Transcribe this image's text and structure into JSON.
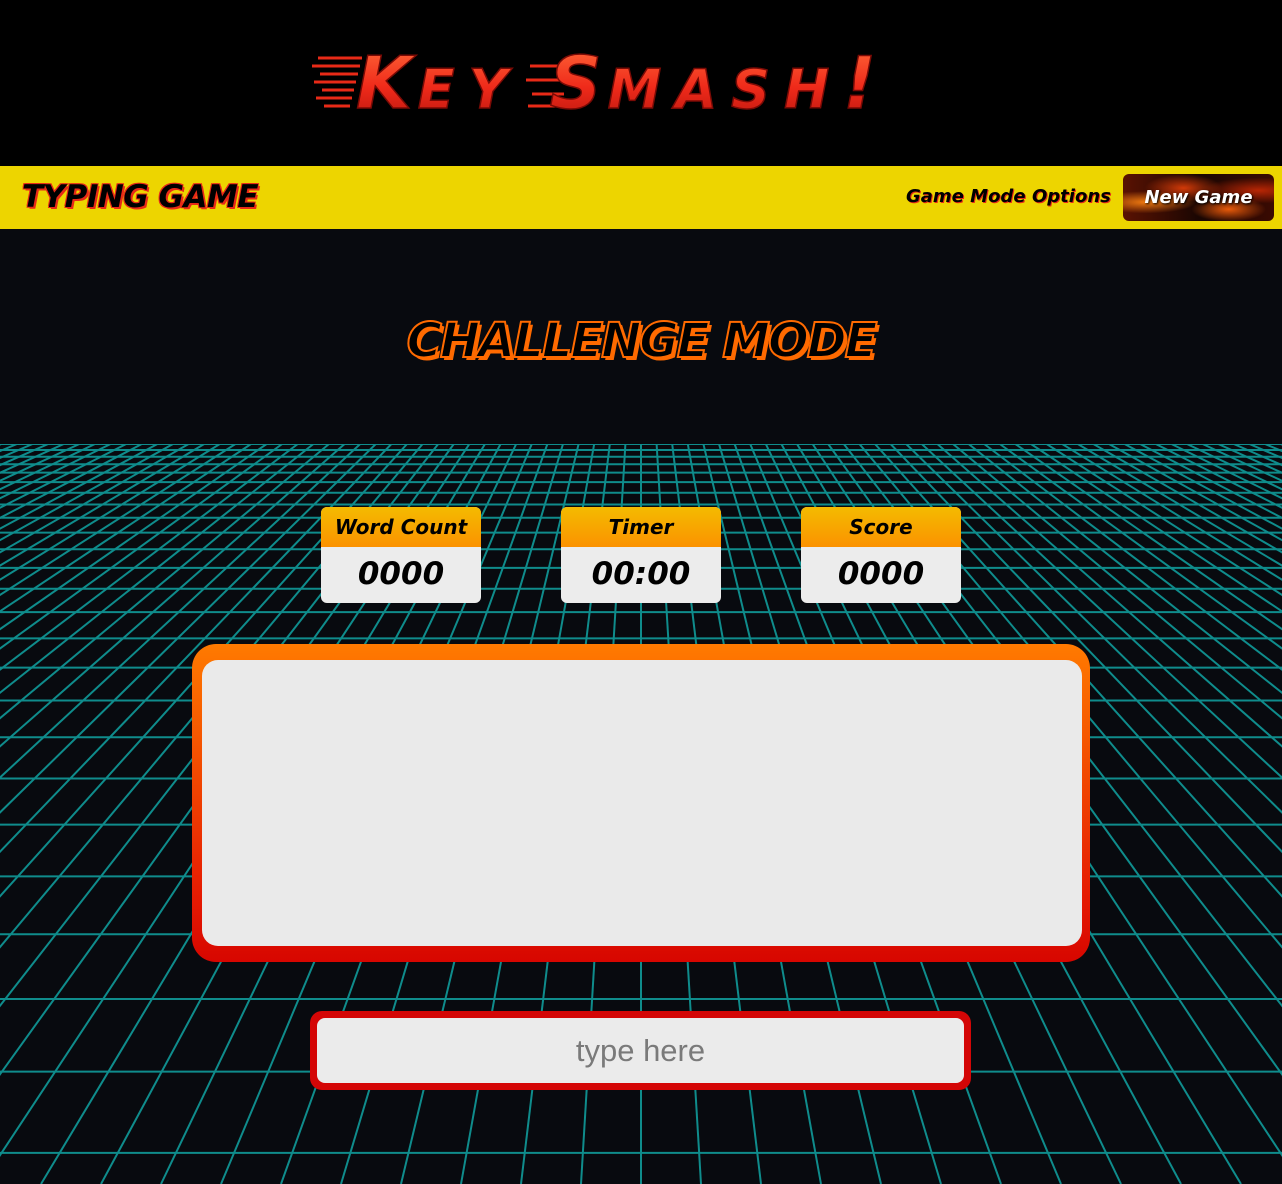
{
  "logo": {
    "text": "Key Smash!",
    "alt_letters": [
      "K",
      "EY",
      "S",
      "MASH",
      "!"
    ]
  },
  "nav": {
    "brand": "TYPING GAME",
    "links": [
      "Game Mode",
      "Options"
    ],
    "new_game_label": "New Game"
  },
  "main": {
    "mode_title": "CHALLENGE MODE"
  },
  "stats": {
    "word_count": {
      "label": "Word Count",
      "value": "0000"
    },
    "timer": {
      "label": "Timer",
      "value": "00:00"
    },
    "score": {
      "label": "Score",
      "value": "0000"
    }
  },
  "word_display": {
    "text": ""
  },
  "input": {
    "placeholder": "type here",
    "value": ""
  },
  "colors": {
    "logo_fill": "#e82a17",
    "nav_background": "#edd500",
    "mode_title_outline": "#ff6a00",
    "grid_line": "#0f9090",
    "stat_header": "#f4bb00",
    "frame_top": "#ff7a00",
    "frame_bottom": "#d70600",
    "input_border": "#d40606"
  }
}
